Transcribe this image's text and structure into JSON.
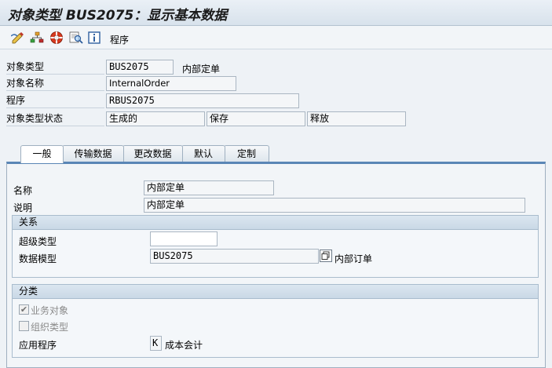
{
  "window": {
    "title": "对象类型 BUS2075：显示基本数据"
  },
  "toolbar": {
    "icons": [
      "edit-pencil-icon",
      "hierarchy-icon",
      "lifesaver-icon",
      "search-magnifier-icon",
      "info-icon"
    ],
    "program_label": "程序"
  },
  "header": {
    "object_type_label": "对象类型",
    "object_type_value": "BUS2075",
    "object_type_desc": "内部定单",
    "object_name_label": "对象名称",
    "object_name_value": "InternalOrder",
    "program_label": "程序",
    "program_value": "RBUS2075",
    "status_label": "对象类型状态",
    "status_values": [
      "生成的",
      "保存",
      "释放"
    ]
  },
  "tabs": [
    {
      "label": "一般",
      "active": true
    },
    {
      "label": "传输数据",
      "active": false
    },
    {
      "label": "更改数据",
      "active": false
    },
    {
      "label": "默认",
      "active": false
    },
    {
      "label": "定制",
      "active": false
    }
  ],
  "general": {
    "name_label": "名称",
    "name_value": "内部定单",
    "desc_label": "说明",
    "desc_value": "内部定单"
  },
  "relations": {
    "title": "关系",
    "supertype_label": "超级类型",
    "supertype_value": "",
    "datamodel_label": "数据模型",
    "datamodel_value": "BUS2075",
    "datamodel_desc": "内部订单"
  },
  "classification": {
    "title": "分类",
    "business_object_label": "业务对象",
    "business_object_checked": true,
    "org_type_label": "组织类型",
    "org_type_checked": false,
    "application_label": "应用程序",
    "application_value": "K",
    "application_desc": "成本会计"
  }
}
